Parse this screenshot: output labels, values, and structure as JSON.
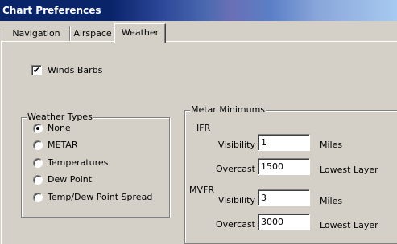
{
  "window": {
    "title": "Chart Preferences"
  },
  "tabs": [
    {
      "label": "Navigation",
      "active": false
    },
    {
      "label": "Airspace",
      "active": false
    },
    {
      "label": "Weather",
      "active": true
    }
  ],
  "wind_barbs": {
    "label": "Winds Barbs",
    "checked": true
  },
  "weather_types": {
    "title": "Weather Types",
    "selected": "None",
    "options": [
      "None",
      "METAR",
      "Temperatures",
      "Dew Point",
      "Temp/Dew Point Spread"
    ]
  },
  "metar_minimums": {
    "title": "Metar Minimums",
    "ifr": {
      "label": "IFR",
      "visibility_label": "Visibility",
      "visibility_value": "1",
      "visibility_unit": "Miles",
      "overcast_label": "Overcast",
      "overcast_value": "1500",
      "overcast_unit": "Lowest Layer"
    },
    "mvfr": {
      "label": "MVFR",
      "visibility_label": "Visibility",
      "visibility_value": "3",
      "visibility_unit": "Miles",
      "overcast_label": "Overcast",
      "overcast_value": "3000",
      "overcast_unit": "Lowest Layer"
    }
  }
}
